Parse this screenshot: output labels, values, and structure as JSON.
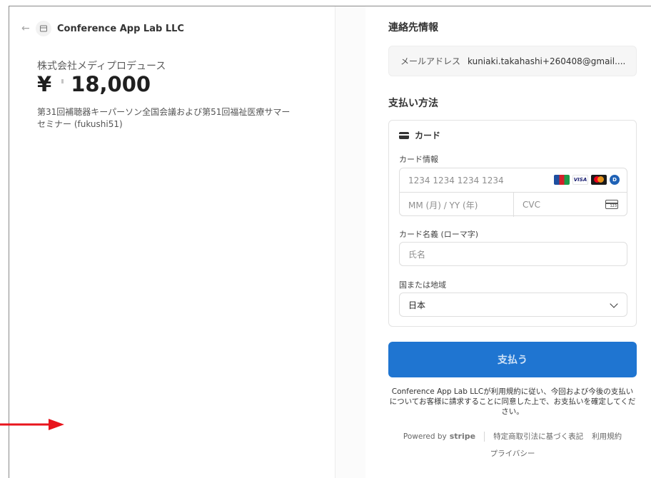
{
  "merchant": {
    "name": "Conference App Lab LLC"
  },
  "product": {
    "company": "株式会社メディプロデュース",
    "currency_symbol": "¥",
    "amount": "18,000",
    "description": "第31回補聴器キーパーソン全国会議および第51回福祉医療サマーセミナー (fukushi51)"
  },
  "contact": {
    "title": "連絡先情報",
    "email_label": "メールアドレス",
    "email_value": "kuniaki.takahashi+260408@gmail...."
  },
  "payment": {
    "title": "支払い方法",
    "method_label": "カード",
    "card_info_label": "カード情報",
    "card_number_placeholder": "1234 1234 1234 1234",
    "expiry_placeholder": "MM (月) / YY (年)",
    "cvc_placeholder": "CVC",
    "card_brands": [
      "JCB",
      "VISA",
      "Mastercard",
      "Diners"
    ],
    "name_label": "カード名義 (ローマ字)",
    "name_placeholder": "氏名",
    "country_label": "国または地域",
    "country_value": "日本"
  },
  "pay_button": {
    "label": "支払う"
  },
  "consent_text": "Conference App Lab LLCが利用規約に従い、今回および今後の支払いについてお客様に請求することに同意した上で、お支払いを確定してください。",
  "footer": {
    "powered_by": "Powered by",
    "brand": "stripe",
    "links": [
      "特定商取引法に基づく表記",
      "利用規約",
      "プライバシー"
    ]
  },
  "colors": {
    "pay_button": "#1f75d1",
    "annotation_arrow": "#e8141c"
  }
}
